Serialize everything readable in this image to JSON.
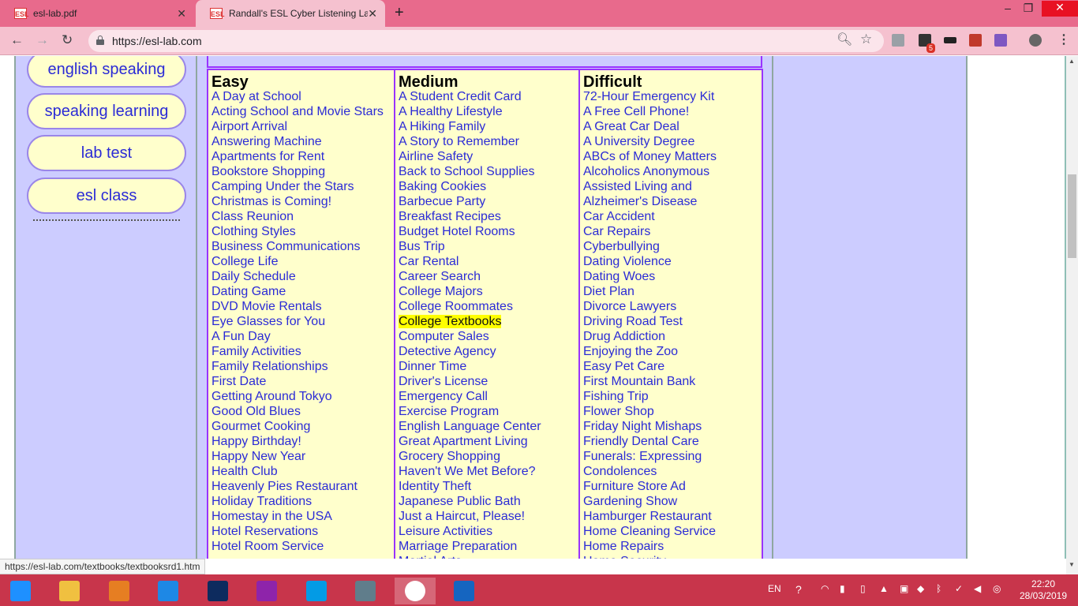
{
  "browser": {
    "tabs": [
      {
        "label": "esl-lab.pdf",
        "favicon": "ESL"
      },
      {
        "label": "Randall's ESL Cyber Listening Lab",
        "favicon": "ESL"
      }
    ],
    "url": "https://esl-lab.com",
    "status_url": "https://esl-lab.com/textbooks/textbooksrd1.htm",
    "extension_badge": "5"
  },
  "sidebar": {
    "buttons": [
      {
        "label": "english speaking"
      },
      {
        "label": "speaking learning"
      },
      {
        "label": "lab test"
      },
      {
        "label": "esl class"
      }
    ]
  },
  "lessons": {
    "easy": {
      "heading": "Easy",
      "items": [
        "A Day at School",
        "Acting School and Movie Stars",
        "Airport Arrival",
        "Answering Machine",
        "Apartments for Rent",
        "Bookstore Shopping",
        "Camping Under the Stars",
        "Christmas is Coming!",
        "Class Reunion",
        "Clothing Styles",
        "Business Communications",
        "College Life",
        "Daily Schedule",
        "Dating Game",
        "DVD Movie Rentals",
        "Eye Glasses for You",
        "A Fun Day",
        "Family Activities",
        "Family Relationships",
        "First Date",
        "Getting Around Tokyo",
        "Good Old Blues",
        "Gourmet Cooking",
        "Happy Birthday!",
        "Happy New Year",
        "Health Club",
        "Heavenly Pies Restaurant",
        "Holiday Traditions",
        "Homestay in the USA",
        "Hotel Reservations",
        "Hotel Room Service"
      ]
    },
    "medium": {
      "heading": "Medium",
      "highlighted_index": 15,
      "items": [
        "A Student Credit Card",
        "A Healthy Lifestyle",
        "A Hiking Family",
        "A Story to Remember",
        "Airline Safety",
        "Back to School Supplies",
        "Baking Cookies",
        "Barbecue Party",
        "Breakfast Recipes",
        "Budget Hotel Rooms",
        "Bus Trip",
        "Car Rental",
        "Career Search",
        "College Majors",
        "College Roommates",
        "College Textbooks",
        "Computer Sales",
        "Detective Agency",
        "Dinner Time",
        "Driver's License",
        "Emergency Call",
        "Exercise Program",
        "English Language Center",
        "Great Apartment Living",
        "Grocery Shopping",
        "Haven't We Met Before?",
        "Identity Theft",
        "Japanese Public Bath",
        "Just a Haircut, Please!",
        "Leisure Activities",
        "Marriage Preparation",
        "Martial Arts"
      ]
    },
    "difficult": {
      "heading": "Difficult",
      "items": [
        "72-Hour Emergency Kit",
        "A Free Cell Phone!",
        "A Great Car Deal",
        "A University Degree",
        "ABCs of Money Matters",
        "Alcoholics Anonymous",
        "Assisted Living and",
        "Alzheimer's Disease",
        "Car Accident",
        "Car Repairs",
        "Cyberbullying",
        "Dating Violence",
        "Dating Woes",
        "Diet Plan",
        "Divorce Lawyers",
        "Driving Road Test",
        "Drug Addiction",
        "Enjoying the Zoo",
        "Easy Pet Care",
        "First Mountain Bank",
        "Fishing Trip",
        "Flower Shop",
        "Friday Night Mishaps",
        "Friendly Dental Care",
        "Funerals: Expressing",
        "Condolences",
        "Furniture Store Ad",
        "Gardening Show",
        "Hamburger Restaurant",
        "Home Cleaning Service",
        "Home Repairs",
        "Home Security"
      ]
    }
  },
  "taskbar": {
    "apps": [
      "start-icon",
      "file-explorer-icon",
      "media-player-icon",
      "internet-explorer-icon",
      "photoshop-icon",
      "camera-app-icon",
      "celcom-broadband-icon",
      "network-settings-icon",
      "chrome-icon",
      "word-icon"
    ],
    "language": "EN",
    "time": "22:20",
    "date": "28/03/2019"
  },
  "colors": {
    "tab_strip": "#e86a8c",
    "page_bg": "#ccccff",
    "table_bg": "#ffffcc",
    "table_border": "#9933ff",
    "link": "#2b2bd6",
    "highlight": "#ffff00",
    "taskbar": "#c8354b"
  }
}
